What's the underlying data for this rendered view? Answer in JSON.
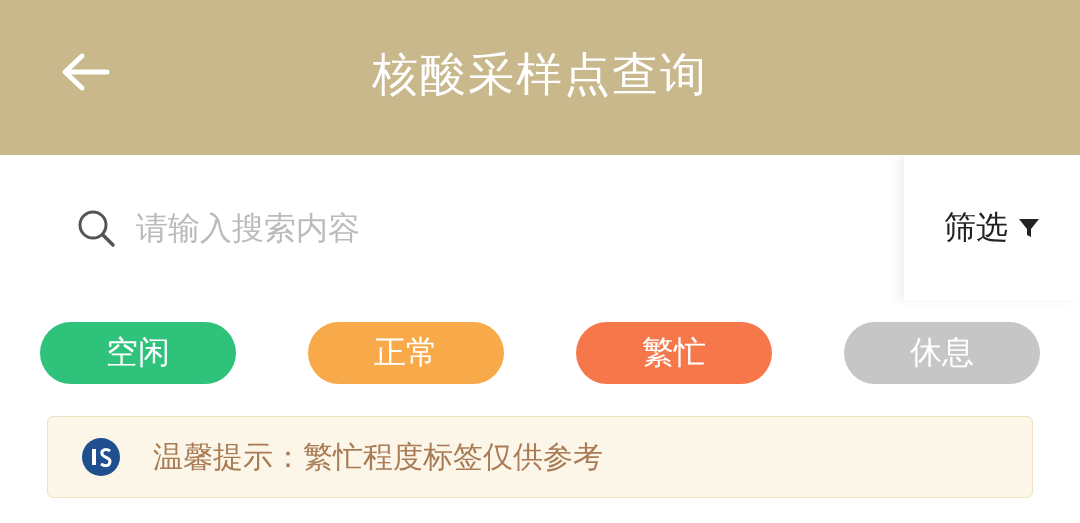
{
  "header": {
    "title": "核酸采样点查询"
  },
  "search": {
    "placeholder": "请输入搜索内容"
  },
  "filter": {
    "label": "筛选"
  },
  "statuses": [
    {
      "label": "空闲",
      "color": "#2ec27a"
    },
    {
      "label": "正常",
      "color": "#f8aa4b"
    },
    {
      "label": "繁忙",
      "color": "#f6784a"
    },
    {
      "label": "休息",
      "color": "#c6c6c6"
    }
  ],
  "tip": {
    "text": "温馨提示：繁忙程度标签仅供参考"
  }
}
